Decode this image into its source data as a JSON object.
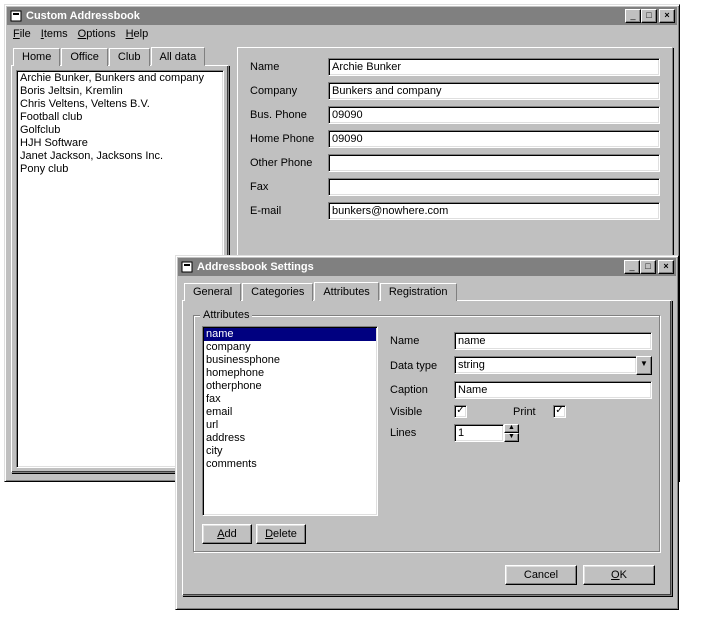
{
  "main": {
    "title": "Custom Addressbook",
    "menu": {
      "file": "File",
      "items": "Items",
      "options": "Options",
      "help": "Help"
    },
    "tabs": [
      "Home",
      "Office",
      "Club",
      "All data"
    ],
    "active_tab": 3,
    "list": [
      "Archie Bunker, Bunkers and company",
      "Boris Jeltsin, Kremlin",
      "Chris Veltens, Veltens B.V.",
      "Football club",
      "Golfclub",
      "HJH Software",
      "Janet Jackson, Jacksons Inc.",
      "Pony club"
    ],
    "fields": [
      {
        "label": "Name",
        "value": "Archie Bunker"
      },
      {
        "label": "Company",
        "value": "Bunkers and company"
      },
      {
        "label": "Bus. Phone",
        "value": "09090"
      },
      {
        "label": "Home Phone",
        "value": "09090"
      },
      {
        "label": "Other Phone",
        "value": ""
      },
      {
        "label": "Fax",
        "value": ""
      },
      {
        "label": "E-mail",
        "value": "bunkers@nowhere.com"
      }
    ]
  },
  "settings": {
    "title": "Addressbook Settings",
    "tabs": [
      "General",
      "Categories",
      "Attributes",
      "Registration"
    ],
    "active_tab": 2,
    "group_label": "Attributes",
    "attr_list": [
      "name",
      "company",
      "businessphone",
      "homephone",
      "otherphone",
      "fax",
      "email",
      "url",
      "address",
      "city",
      "comments"
    ],
    "selected_attr": 0,
    "form": {
      "name_label": "Name",
      "name_value": "name",
      "datatype_label": "Data type",
      "datatype_value": "string",
      "caption_label": "Caption",
      "caption_value": "Name",
      "visible_label": "Visible",
      "visible_checked": true,
      "print_label": "Print",
      "print_checked": true,
      "lines_label": "Lines",
      "lines_value": "1"
    },
    "add_label": "Add",
    "delete_label": "Delete",
    "cancel_label": "Cancel",
    "ok_label": "OK"
  }
}
